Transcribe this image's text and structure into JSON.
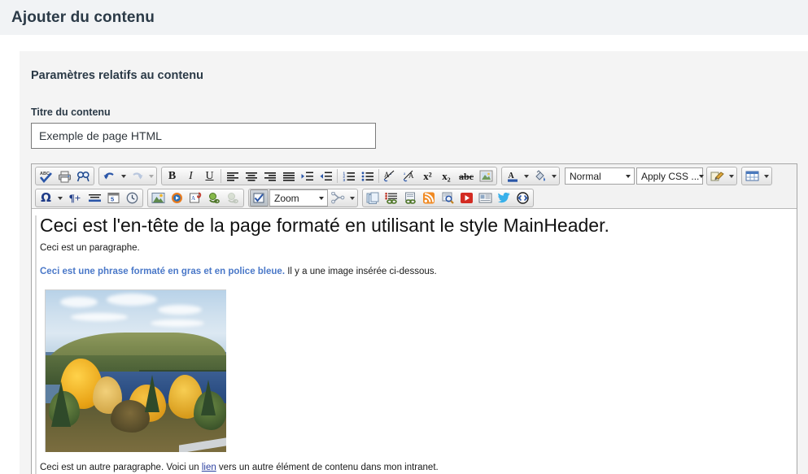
{
  "header": {
    "title": "Ajouter du contenu"
  },
  "panel": {
    "heading": "Paramètres relatifs au contenu",
    "title_field": {
      "label": "Titre du contenu",
      "value": "Exemple de page HTML",
      "placeholder": "Titre du contenu"
    }
  },
  "editor": {
    "toolbar_row1": {
      "group1": [
        {
          "name": "spellcheck-icon",
          "title": "Vérifier l'orthographe"
        },
        {
          "name": "print-icon",
          "title": "Imprimer"
        },
        {
          "name": "find-replace-icon",
          "title": "Rechercher"
        }
      ],
      "group2": [
        {
          "name": "undo-icon",
          "title": "Annuler"
        },
        {
          "name": "redo-icon",
          "title": "Rétablir"
        }
      ],
      "group3": [
        {
          "name": "bold-icon",
          "glyph": "B",
          "title": "Gras"
        },
        {
          "name": "italic-icon",
          "glyph": "I",
          "title": "Italique"
        },
        {
          "name": "underline-icon",
          "glyph": "U",
          "title": "Souligné"
        }
      ],
      "group4": [
        {
          "name": "align-left-icon",
          "title": "Aligner à gauche"
        },
        {
          "name": "align-center-icon",
          "title": "Centrer"
        },
        {
          "name": "align-right-icon",
          "title": "Aligner à droite"
        },
        {
          "name": "align-justify-icon",
          "title": "Justifier"
        },
        {
          "name": "increase-indent-icon",
          "title": "Augmenter le retrait"
        },
        {
          "name": "decrease-indent-icon",
          "title": "Diminuer le retrait"
        },
        {
          "name": "ordered-list-icon",
          "title": "Liste numérotée"
        },
        {
          "name": "unordered-list-icon",
          "title": "Liste à puces"
        },
        {
          "name": "remove-format-icon",
          "title": "Supprimer la mise en forme"
        },
        {
          "name": "apply-format-icon",
          "title": "Appliquer la mise en forme"
        },
        {
          "name": "superscript-icon",
          "glyph": "x²",
          "title": "Exposant"
        },
        {
          "name": "subscript-icon",
          "glyph": "x₂",
          "title": "Indice"
        },
        {
          "name": "strikethrough-icon",
          "glyph": "abc",
          "title": "Barré"
        },
        {
          "name": "image-placeholder-icon",
          "title": "Image"
        }
      ],
      "group5": [
        {
          "name": "text-color-icon",
          "title": "Couleur du texte"
        },
        {
          "name": "highlight-color-icon",
          "title": "Couleur de surbrillance"
        }
      ],
      "format_select": {
        "name": "format-select",
        "value": "Normal"
      },
      "css_select": {
        "name": "apply-css-select",
        "value": "Apply CSS ..."
      },
      "group6": [
        {
          "name": "format-painter-icon",
          "title": "Reproduire la mise en forme"
        }
      ],
      "group7": [
        {
          "name": "table-icon",
          "title": "Tableau"
        }
      ]
    },
    "toolbar_row2": {
      "group1": [
        {
          "name": "special-character-icon",
          "glyph": "Ω",
          "title": "Caractère spécial"
        },
        {
          "name": "paragraph-insert-icon",
          "glyph": "¶+",
          "title": "Insérer un paragraphe"
        },
        {
          "name": "horizontal-rule-icon",
          "title": "Ligne horizontale"
        },
        {
          "name": "insert-date-icon",
          "title": "Insérer une date"
        },
        {
          "name": "insert-time-icon",
          "title": "Insérer l'heure"
        }
      ],
      "group2": [
        {
          "name": "insert-image-icon",
          "title": "Insérer une image"
        },
        {
          "name": "insert-media-icon",
          "title": "Insérer un média"
        },
        {
          "name": "insert-attachment-icon",
          "title": "Joindre un fichier"
        },
        {
          "name": "insert-link-icon",
          "title": "Insérer un lien"
        },
        {
          "name": "remove-link-icon",
          "title": "Supprimer le lien"
        }
      ],
      "zoom_button": {
        "name": "zoom-toggle-button",
        "pressed": true
      },
      "zoom_select": {
        "name": "zoom-select",
        "value": "Zoom"
      },
      "group3": [
        {
          "name": "anchor-icon",
          "title": "Ancre"
        }
      ],
      "group4": [
        {
          "name": "copy-pages-icon",
          "title": "Copier des pages"
        },
        {
          "name": "list-link-icon",
          "title": "Lien vers une liste"
        },
        {
          "name": "page-link-icon",
          "title": "Lien vers une page"
        },
        {
          "name": "rss-feed-icon",
          "title": "Flux RSS"
        },
        {
          "name": "preview-search-icon",
          "title": "Aperçu"
        },
        {
          "name": "video-icon",
          "title": "Vidéo"
        },
        {
          "name": "news-icon",
          "title": "Actualités"
        },
        {
          "name": "twitter-icon",
          "title": "Twitter"
        },
        {
          "name": "embed-code-icon",
          "title": "Code intégré"
        }
      ]
    },
    "content": {
      "heading": "Ceci est l'en-tête de la page formaté en utilisant le style MainHeader.",
      "paragraph1": "Ceci est un paragraphe.",
      "paragraph2_bold_blue": "Ceci est une phrase formaté en gras et en police bleue.",
      "paragraph2_rest": " Il y a une image insérée ci-dessous.",
      "image": {
        "name": "autumn-lake-photo",
        "alt": "Paysage d'automne avec un lac"
      },
      "paragraph3_before": "Ceci est un autre paragraphe. Voici un ",
      "paragraph3_link": "lien",
      "paragraph3_after": " vers un autre élément de contenu dans mon intranet."
    }
  },
  "colors": {
    "page_header_bg": "#f1f3f5",
    "panel_bg": "#f4f4f4",
    "toolbar_bg": "#f2f2f2",
    "blue_text": "#4a78c8",
    "link": "#2b3fa0",
    "title_text": "#2b3a47"
  }
}
